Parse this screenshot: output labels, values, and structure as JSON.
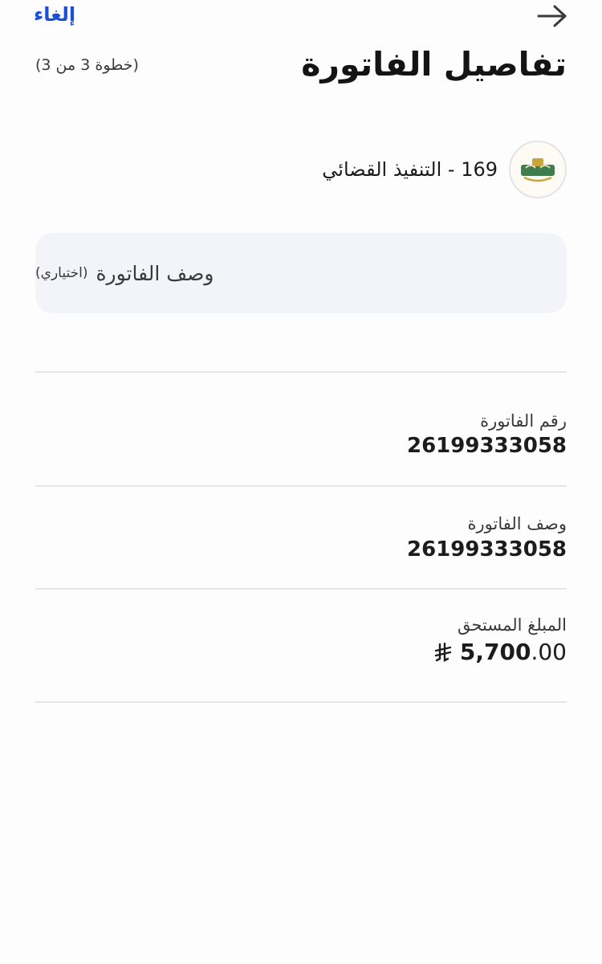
{
  "header": {
    "cancel_label": "إلغاء",
    "title": "تفاصيل الفاتورة",
    "step": "(خطوة 3 من 3)"
  },
  "biller": {
    "name": "169 - التنفيذ القضائي",
    "logo_icon": "ministry-of-justice-logo"
  },
  "description_field": {
    "label": "وصف الفاتورة",
    "optional_label": "(اختياري)"
  },
  "details": {
    "invoice_number_label": "رقم الفاتورة",
    "invoice_number_value": "26199333058",
    "invoice_desc_label": "وصف الفاتورة",
    "invoice_desc_value": "26199333058",
    "amount_label": "المبلغ المستحق",
    "amount_integer": "5,700",
    "amount_decimal": ".00",
    "currency_icon": "saudi-riyal-icon"
  },
  "colors": {
    "accent": "#1a4fd6",
    "field_bg": "#f3f4f9",
    "divider": "#e6e6ea"
  }
}
